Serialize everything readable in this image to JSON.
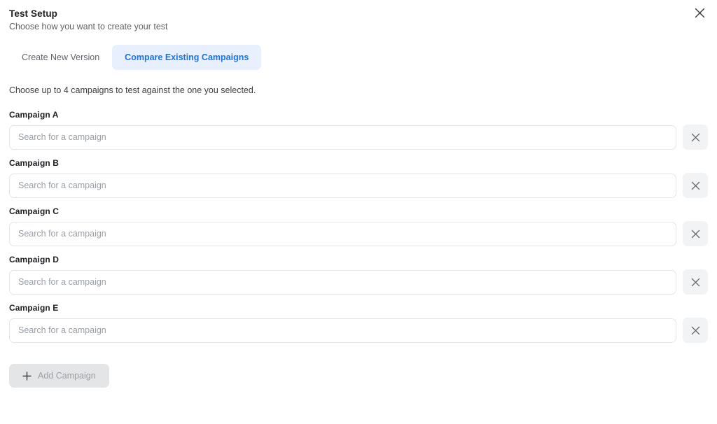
{
  "header": {
    "title": "Test Setup",
    "subtitle": "Choose how you want to create your test",
    "close_icon": "close-icon"
  },
  "tabs": [
    {
      "label": "Create New Version",
      "active": false
    },
    {
      "label": "Compare Existing Campaigns",
      "active": true
    }
  ],
  "instruction": "Choose up to 4 campaigns to test against the one you selected.",
  "campaign_rows": [
    {
      "label": "Campaign A",
      "value": "",
      "placeholder": "Search for a campaign",
      "remove_icon": "close-icon"
    },
    {
      "label": "Campaign B",
      "value": "",
      "placeholder": "Search for a campaign",
      "remove_icon": "close-icon"
    },
    {
      "label": "Campaign C",
      "value": "",
      "placeholder": "Search for a campaign",
      "remove_icon": "close-icon"
    },
    {
      "label": "Campaign D",
      "value": "",
      "placeholder": "Search for a campaign",
      "remove_icon": "close-icon"
    },
    {
      "label": "Campaign E",
      "value": "",
      "placeholder": "Search for a campaign",
      "remove_icon": "close-icon"
    }
  ],
  "add_campaign": {
    "label": "Add Campaign",
    "icon": "plus-icon",
    "disabled": true
  },
  "colors": {
    "accent": "#1a73e8",
    "accent_bg": "#e8f0fe",
    "text_primary": "#202124",
    "text_secondary": "#5f6368",
    "placeholder": "#9aa0a6",
    "border": "#e3e5e8",
    "button_bg": "#f1f3f4",
    "disabled_bg": "#e4e5e6"
  }
}
